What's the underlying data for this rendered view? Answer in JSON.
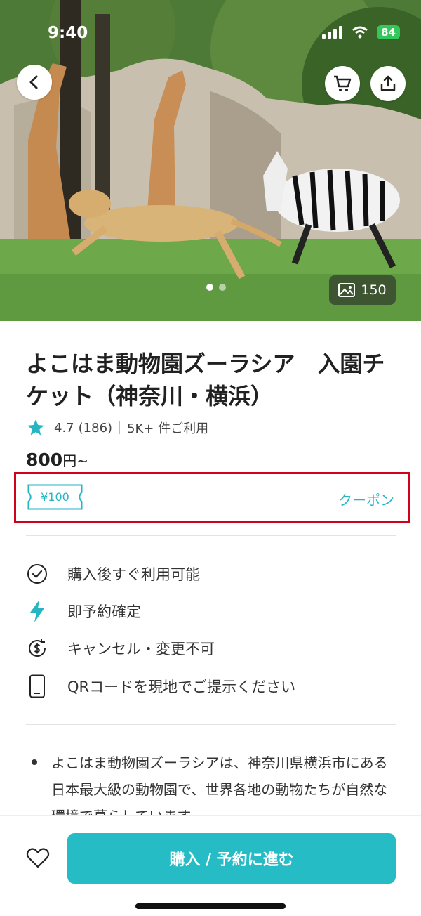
{
  "status": {
    "time": "9:40",
    "battery": "84"
  },
  "gallery": {
    "photo_count": "150"
  },
  "product": {
    "title": "よこはま動物園ズーラシア　入園チケット（神奈川・横浜）",
    "rating": "4.7",
    "reviews": "(186)",
    "usage": "5K+ 件ご利用",
    "price": "800",
    "price_unit": "円~"
  },
  "coupon": {
    "amount": "¥100",
    "link_label": "クーポン"
  },
  "features": [
    {
      "icon": "check-circle-icon",
      "label": "購入後すぐ利用可能"
    },
    {
      "icon": "lightning-icon",
      "label": "即予約確定"
    },
    {
      "icon": "refund-icon",
      "label": "キャンセル・変更不可"
    },
    {
      "icon": "phone-icon",
      "label": "QRコードを現地でご提示ください"
    }
  ],
  "description": {
    "text": "よこはま動物園ズーラシアは、神奈川県横浜市にある日本最大級の動物園で、世界各地の動物たちが自然な環境で暮らしています。"
  },
  "actions": {
    "cta_label": "購入 / 予約に進む"
  },
  "colors": {
    "accent": "#26bcc6",
    "highlight_border": "#d0021b",
    "star": "#26b5c3"
  }
}
